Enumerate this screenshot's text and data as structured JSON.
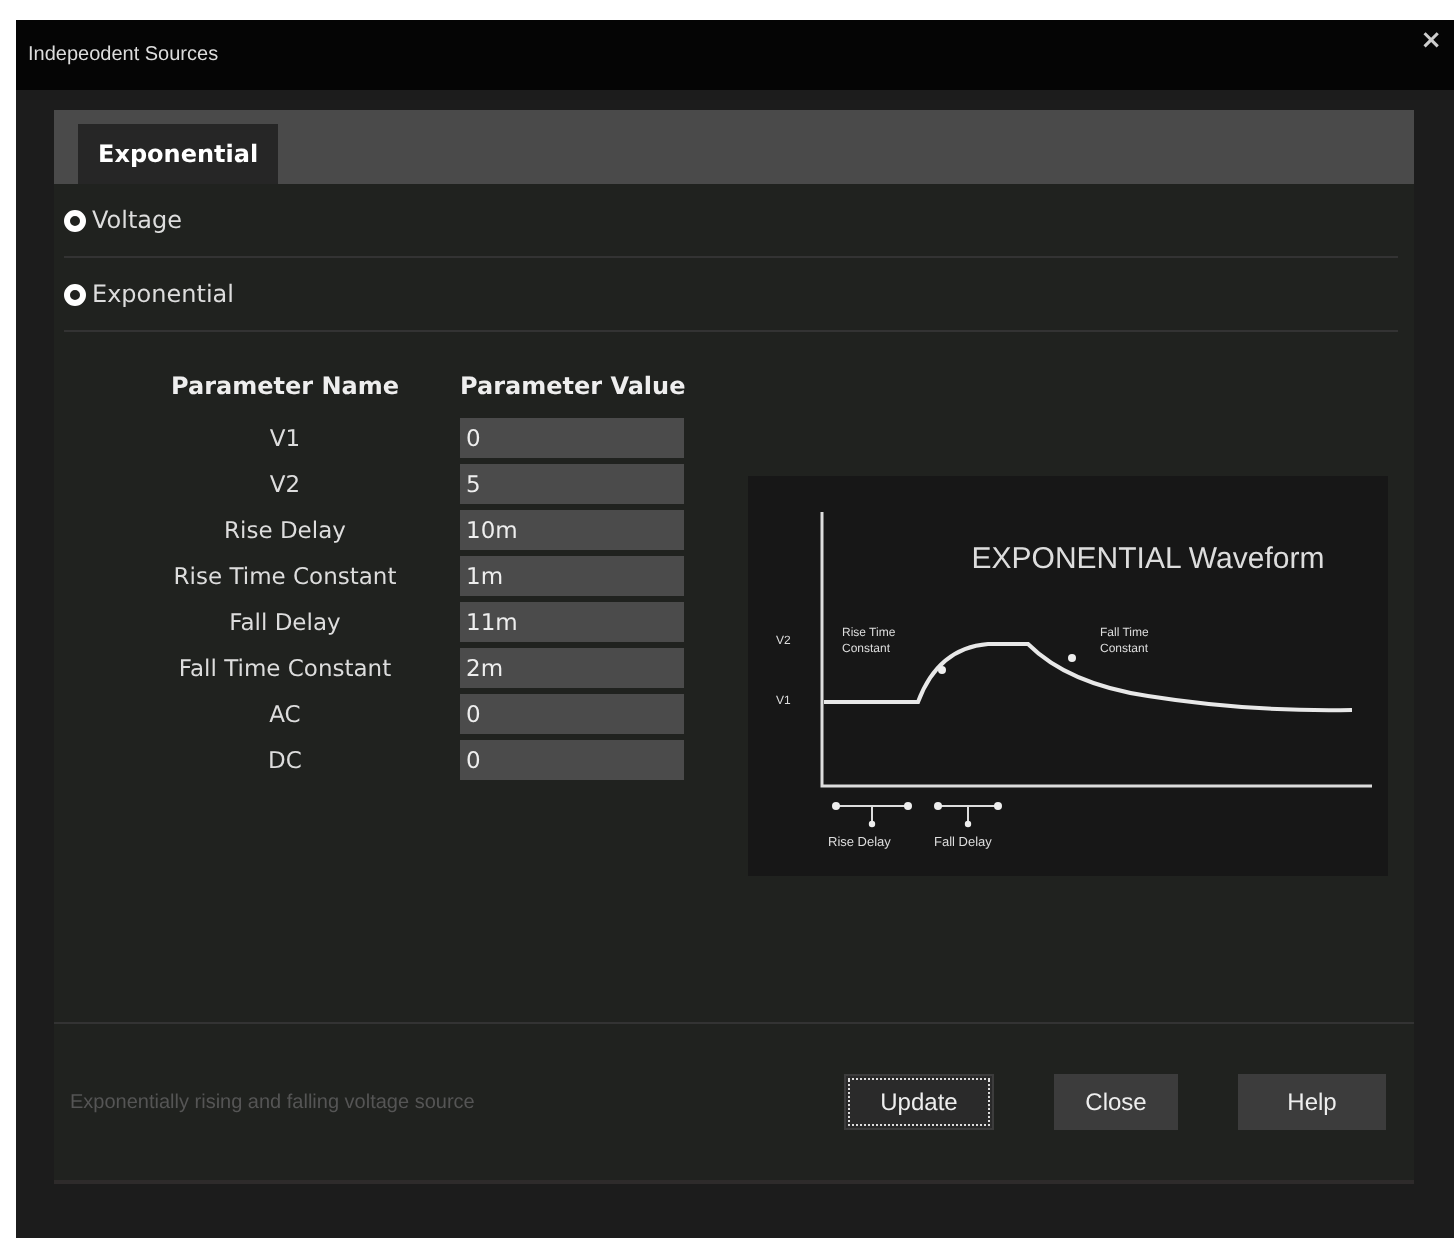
{
  "window": {
    "title": "Indepeodent Sources",
    "close": "×"
  },
  "tabs": [
    {
      "label": "Exponential",
      "selected": true
    }
  ],
  "sections": [
    {
      "label": "Voltage"
    },
    {
      "label": "Exponential"
    }
  ],
  "parameters": {
    "columns": [
      "Parameter Name",
      "Parameter Value"
    ],
    "rows": [
      {
        "name": "V1",
        "value": "0"
      },
      {
        "name": "V2",
        "value": "5"
      },
      {
        "name": "Rise Delay",
        "value": "10m"
      },
      {
        "name": "Rise Time Constant",
        "value": "1m"
      },
      {
        "name": "Fall Delay",
        "value": "11m"
      },
      {
        "name": "Fall Time Constant",
        "value": "2m"
      },
      {
        "name": "AC",
        "value": "0"
      },
      {
        "name": "DC",
        "value": "0"
      }
    ]
  },
  "waveform": {
    "title": "EXPONENTIAL Waveform",
    "level_labels": [
      "V2",
      "V1"
    ],
    "curve_labels": [
      [
        "Rise Time",
        "Constant"
      ],
      [
        "Fall Time",
        "Constant"
      ]
    ],
    "delay_labels": [
      "Rise Delay",
      "Fall Delay"
    ]
  },
  "footer": {
    "description": "Exponentially rising and falling voltage source",
    "buttons": [
      {
        "label": "Update",
        "focused": true
      },
      {
        "label": "Close",
        "focused": false
      },
      {
        "label": "Help",
        "focused": false
      }
    ]
  }
}
